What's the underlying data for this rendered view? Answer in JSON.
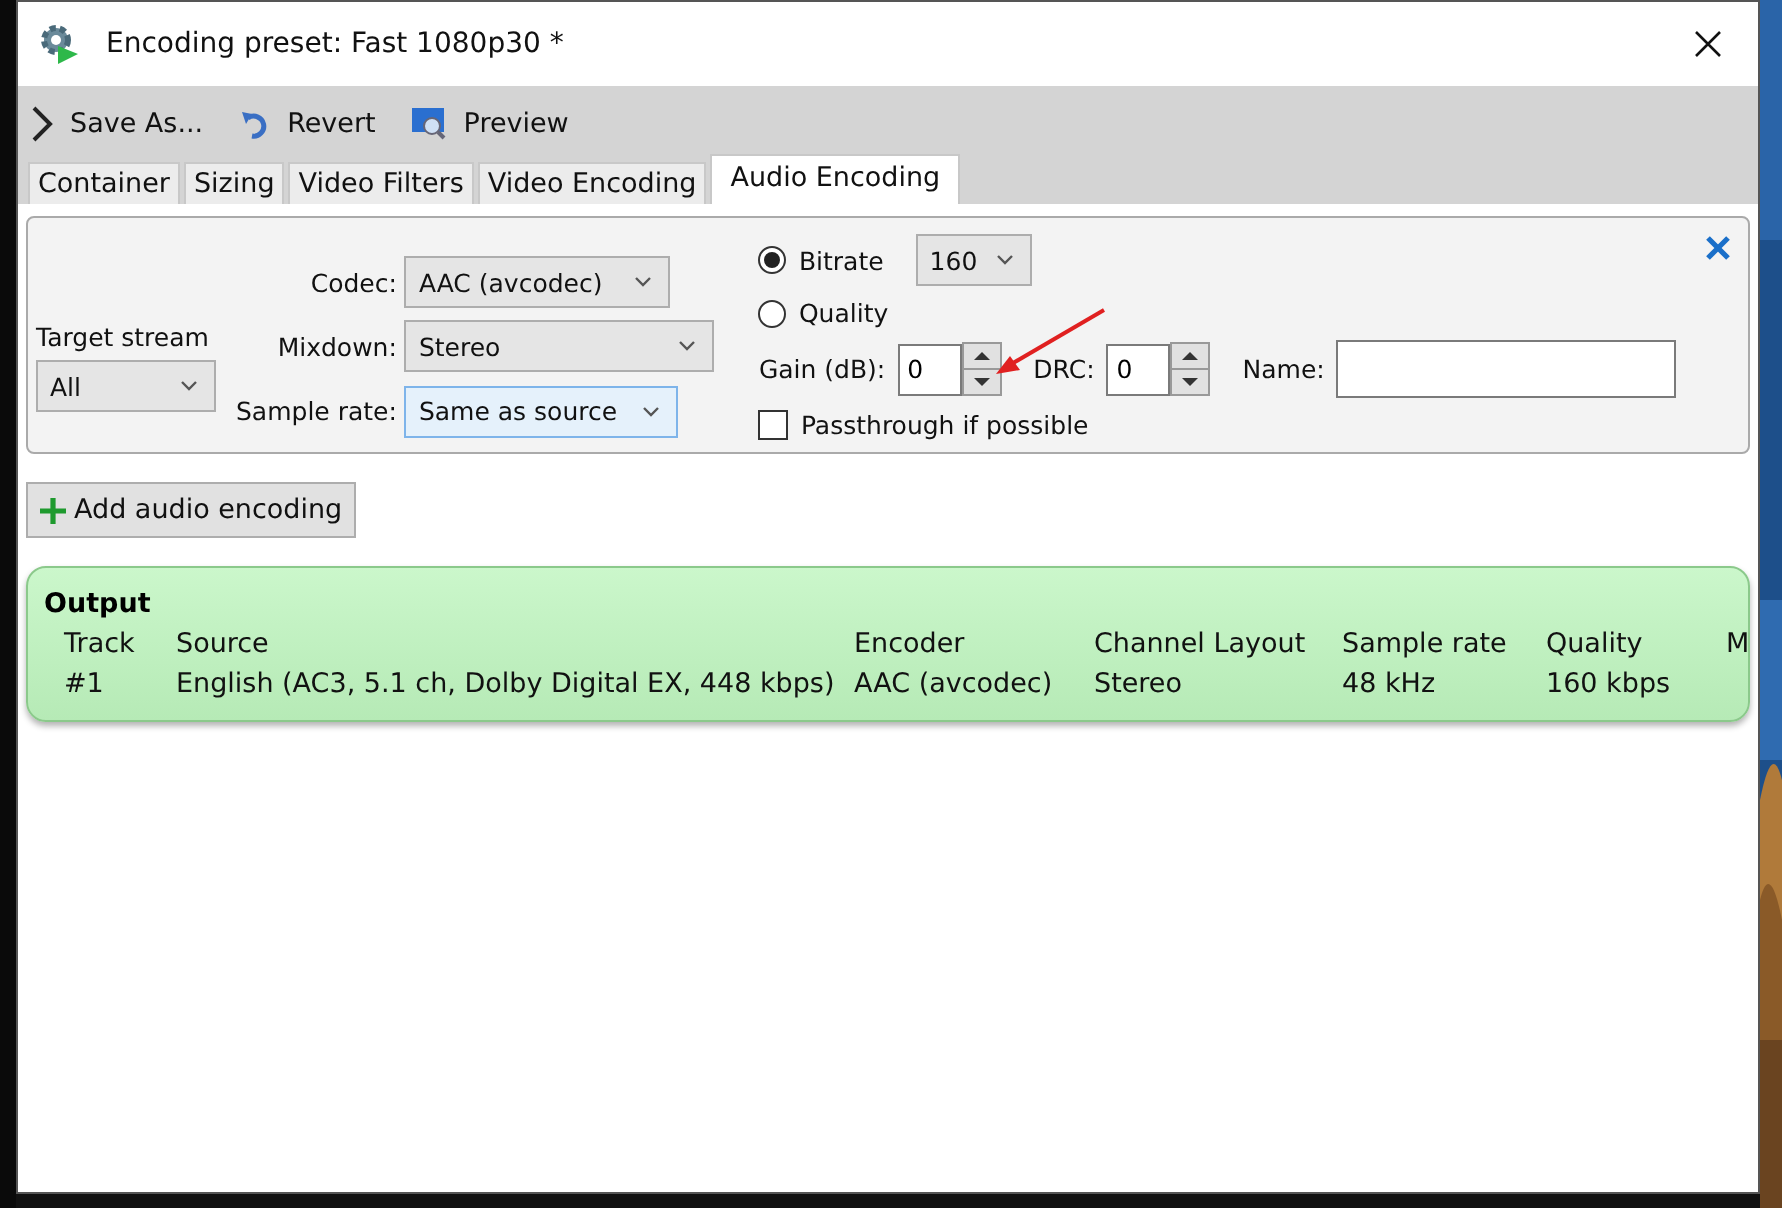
{
  "window": {
    "title": "Encoding preset: Fast 1080p30 *"
  },
  "toolbar": [
    {
      "kind": "expand",
      "label": "Save As..."
    },
    {
      "kind": "revert",
      "label": "Revert"
    },
    {
      "kind": "preview",
      "label": "Preview"
    }
  ],
  "tabs": [
    {
      "label": "Container",
      "selected": false
    },
    {
      "label": "Sizing",
      "selected": false
    },
    {
      "label": "Video Filters",
      "selected": false
    },
    {
      "label": "Video Encoding",
      "selected": false
    },
    {
      "label": "Audio Encoding",
      "selected": true
    }
  ],
  "settings": {
    "target_stream": {
      "label": "Target stream",
      "value": "All"
    },
    "codec": {
      "label": "Codec:",
      "value": "AAC (avcodec)",
      "focused": false
    },
    "mixdown": {
      "label": "Mixdown:",
      "value": "Stereo",
      "focused": false
    },
    "sample_rate": {
      "label": "Sample rate:",
      "value": "Same as source",
      "focused": true
    },
    "rate_mode": [
      {
        "label": "Bitrate",
        "selected": true
      },
      {
        "label": "Quality",
        "selected": false
      }
    ],
    "bitrate": {
      "value": "160"
    },
    "gain": {
      "label": "Gain (dB):",
      "value": "0"
    },
    "drc": {
      "label": "DRC:",
      "value": "0"
    },
    "name": {
      "label": "Name:"
    },
    "passthrough": {
      "label": "Passthrough if possible",
      "checked": false
    }
  },
  "add_button": {
    "label": "Add audio encoding"
  },
  "output": {
    "title": "Output",
    "columns": [
      "Track",
      "Source",
      "Encoder",
      "Channel Layout",
      "Sample rate",
      "Quality",
      "M"
    ],
    "rows": [
      [
        "#1",
        "English (AC3, 5.1 ch, Dolby Digital EX, 448 kbps)",
        "AAC (avcodec)",
        "Stereo",
        "48 kHz",
        "160 kbps",
        ""
      ]
    ]
  }
}
